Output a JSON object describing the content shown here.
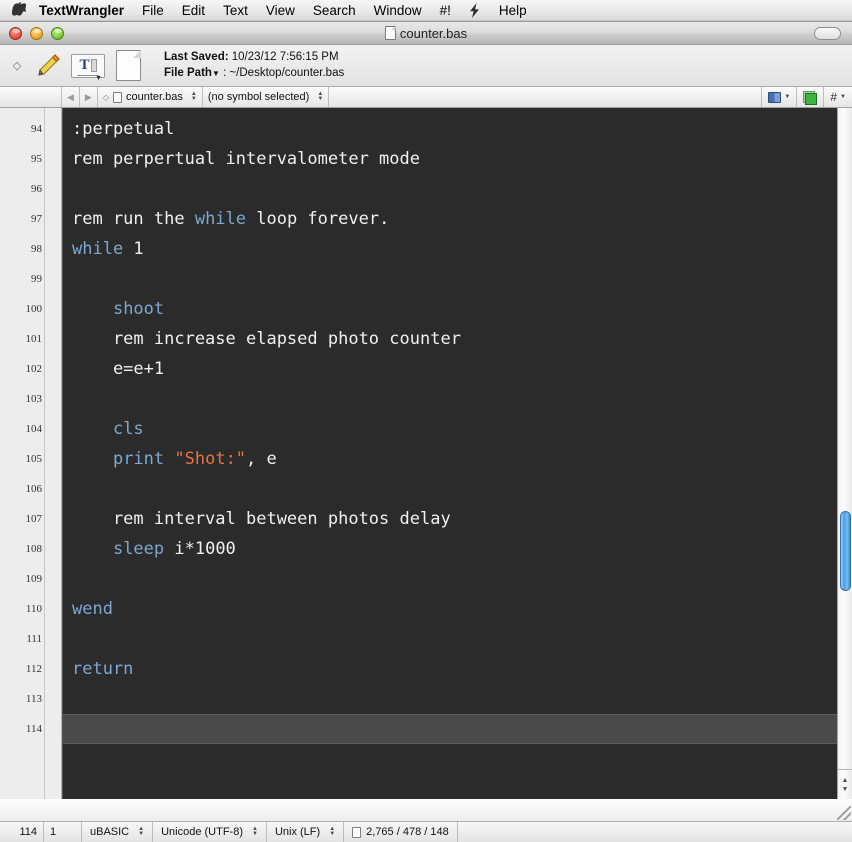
{
  "menubar": {
    "apple_icon": "apple-logo",
    "items": [
      {
        "label": "TextWrangler",
        "bold": true
      },
      {
        "label": "File"
      },
      {
        "label": "Edit"
      },
      {
        "label": "Text"
      },
      {
        "label": "View"
      },
      {
        "label": "Search"
      },
      {
        "label": "Window"
      },
      {
        "label": "#!"
      },
      {
        "label": "Help"
      }
    ],
    "script_icon": "script-lightning-icon"
  },
  "window": {
    "title": "counter.bas",
    "title_icon": "document-icon",
    "toolbar_toggle": "toolbar-toggle-button",
    "traffic_lights": [
      "close",
      "minimize",
      "zoom"
    ]
  },
  "toolbar": {
    "diamond_icon": "diamond-icon",
    "pencil_icon": "pencil-icon",
    "text_options_icon": "text-options-icon",
    "page_icon": "page-icon",
    "last_saved_label": "Last Saved:",
    "last_saved_value": "10/23/12 7:56:15 PM",
    "file_path_label": "File Path",
    "file_path_sep": ":",
    "file_path_value": "~/Desktop/counter.bas"
  },
  "navbar": {
    "back_icon": "back-arrow-icon",
    "forward_icon": "forward-arrow-icon",
    "doc_marker_icon": "diamond-marker-icon",
    "doc_icon": "document-icon",
    "file_popup": "counter.bas",
    "symbol_popup": "(no symbol selected)",
    "book_icon": "book-icon",
    "window_icon": "window-icon",
    "hash_label": "#"
  },
  "editor": {
    "first_line": 94,
    "current_line": 114,
    "lines": [
      {
        "n": 94,
        "tokens": [
          {
            "t": ":perpetual",
            "c": "txt"
          }
        ]
      },
      {
        "n": 95,
        "tokens": [
          {
            "t": "rem perpertual intervalometer mode",
            "c": "txt"
          }
        ]
      },
      {
        "n": 96,
        "tokens": []
      },
      {
        "n": 97,
        "tokens": [
          {
            "t": "rem run the ",
            "c": "txt"
          },
          {
            "t": "while",
            "c": "kw"
          },
          {
            "t": " loop forever.",
            "c": "txt"
          }
        ]
      },
      {
        "n": 98,
        "tokens": [
          {
            "t": "while",
            "c": "kw"
          },
          {
            "t": " 1",
            "c": "txt"
          }
        ]
      },
      {
        "n": 99,
        "tokens": []
      },
      {
        "n": 100,
        "tokens": [
          {
            "t": "    ",
            "c": "txt"
          },
          {
            "t": "shoot",
            "c": "kw"
          }
        ]
      },
      {
        "n": 101,
        "tokens": [
          {
            "t": "    rem increase elapsed photo counter",
            "c": "txt"
          }
        ]
      },
      {
        "n": 102,
        "tokens": [
          {
            "t": "    e=e+1",
            "c": "txt"
          }
        ]
      },
      {
        "n": 103,
        "tokens": []
      },
      {
        "n": 104,
        "tokens": [
          {
            "t": "    ",
            "c": "txt"
          },
          {
            "t": "cls",
            "c": "kw"
          }
        ]
      },
      {
        "n": 105,
        "tokens": [
          {
            "t": "    ",
            "c": "txt"
          },
          {
            "t": "print",
            "c": "kw"
          },
          {
            "t": " ",
            "c": "txt"
          },
          {
            "t": "\"Shot:\"",
            "c": "str"
          },
          {
            "t": ", e",
            "c": "txt"
          }
        ]
      },
      {
        "n": 106,
        "tokens": []
      },
      {
        "n": 107,
        "tokens": [
          {
            "t": "    rem interval between photos delay",
            "c": "txt"
          }
        ]
      },
      {
        "n": 108,
        "tokens": [
          {
            "t": "    ",
            "c": "txt"
          },
          {
            "t": "sleep",
            "c": "kw"
          },
          {
            "t": " i*1000",
            "c": "txt"
          }
        ]
      },
      {
        "n": 109,
        "tokens": []
      },
      {
        "n": 110,
        "tokens": [
          {
            "t": "wend",
            "c": "kw"
          }
        ]
      },
      {
        "n": 111,
        "tokens": []
      },
      {
        "n": 112,
        "tokens": [
          {
            "t": "return",
            "c": "kw"
          }
        ]
      },
      {
        "n": 113,
        "tokens": []
      },
      {
        "n": 114,
        "tokens": [],
        "current": true
      }
    ],
    "colors": {
      "background": "#2b2b2b",
      "text": "#f0f0f0",
      "keyword": "#7da7d0",
      "string": "#e8733f",
      "current_line": "#4a4a4a",
      "gutter_background": "#ededed"
    }
  },
  "scrollbar": {
    "thumb_top_pct": 61,
    "thumb_height_pct": 12,
    "up_arrow": "scroll-up-arrow",
    "down_arrow": "scroll-down-arrow"
  },
  "statusbar": {
    "line": "114",
    "column": "1",
    "language": "uBASIC",
    "encoding": "Unicode (UTF-8)",
    "line_endings": "Unix (LF)",
    "doc_icon": "document-icon",
    "counts": "2,765 / 478 / 148"
  }
}
